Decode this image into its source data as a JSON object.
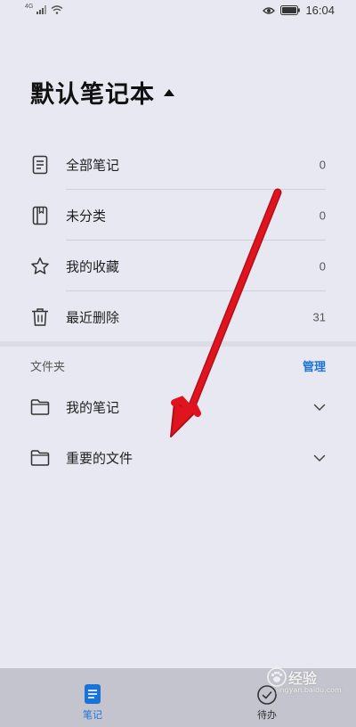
{
  "status_bar": {
    "network": "4G",
    "time": "16:04"
  },
  "notebook": {
    "title": "默认笔记本"
  },
  "list_items": [
    {
      "label": "全部笔记",
      "count": "0",
      "icon": "document-icon"
    },
    {
      "label": "未分类",
      "count": "0",
      "icon": "notebook-icon"
    },
    {
      "label": "我的收藏",
      "count": "0",
      "icon": "star-icon"
    },
    {
      "label": "最近删除",
      "count": "31",
      "icon": "trash-icon"
    }
  ],
  "folders_section": {
    "title": "文件夹",
    "manage_label": "管理"
  },
  "folders": [
    {
      "label": "我的笔记",
      "icon": "folder-icon"
    },
    {
      "label": "重要的文件",
      "icon": "folder-icon"
    }
  ],
  "bottom_nav": {
    "notes_label": "笔记",
    "todo_label": "待办"
  },
  "watermark": {
    "text": "经验",
    "url": "jingyan.baidu.com"
  },
  "colors": {
    "background": "#e8e8f2",
    "accent": "#1a73d9",
    "annotation_arrow": "#e0141e"
  }
}
